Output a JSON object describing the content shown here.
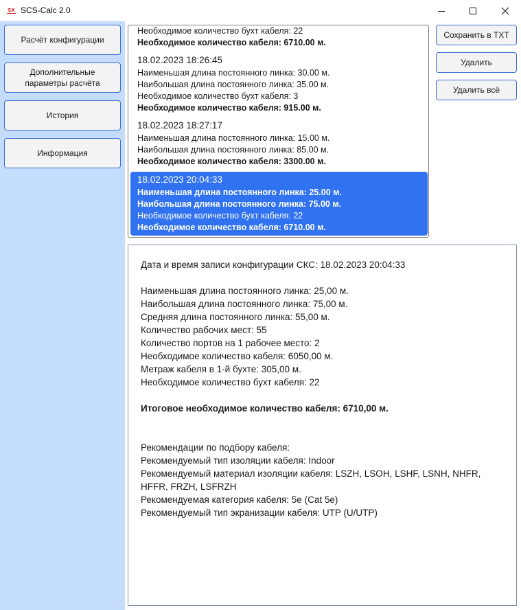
{
  "window": {
    "icon_text": "SX",
    "title": "SCS-Calc 2.0"
  },
  "sidebar": {
    "items": [
      {
        "label": "Расчёт конфигурации"
      },
      {
        "label": "Дополнительные\nпараметры расчёта"
      },
      {
        "label": "История"
      },
      {
        "label": "Информация"
      }
    ]
  },
  "history": {
    "partial": {
      "line1": "Необходимое количество бухт кабеля: 22",
      "line2": "Необходимое количество кабеля: 6710.00 м."
    },
    "entries": [
      {
        "date": "18.02.2023 18:26:45",
        "lines": [
          "Наименьшая длина постоянного линка: 30.00 м.",
          "Наибольшая длина постоянного линка: 35.00 м.",
          "Необходимое количество бухт кабеля: 3"
        ],
        "total": "Необходимое количество кабеля: 915.00 м."
      },
      {
        "date": "18.02.2023 18:27:17",
        "lines": [
          "Наименьшая длина постоянного линка: 15.00 м.",
          "Наибольшая длина постоянного линка: 85.00 м."
        ],
        "total": "Необходимое количество кабеля: 3300.00 м."
      },
      {
        "date": "18.02.2023 20:04:33",
        "lines": [
          "Наименьшая длина постоянного линка: 25.00 м.",
          "Наибольшая длина постоянного линка: 75.00 м.",
          "Необходимое количество бухт кабеля: 22"
        ],
        "total": "Необходимое количество кабеля: 6710.00 м.",
        "selected": true
      }
    ]
  },
  "actions": {
    "save_txt": "Сохранить в TXT",
    "delete": "Удалить",
    "delete_all": "Удалить всё"
  },
  "details": {
    "datetime": "Дата и время записи конфигурации СКС: 18.02.2023 20:04:33",
    "params": [
      "Наименьшая длина постоянного линка: 25,00 м.",
      "Наибольшая длина постоянного линка: 75,00 м.",
      "Средняя длина постоянного линка: 55,00 м.",
      "Количество рабочих мест: 55",
      "Количество портов на 1 рабочее место: 2",
      "Необходимое количество кабеля: 6050,00 м.",
      "Метраж кабеля в 1-й бухте: 305,00 м.",
      "Необходимое количество бухт кабеля: 22"
    ],
    "total": "Итоговое необходимое количество кабеля: 6710,00 м.",
    "recommendations": [
      "Рекомендации по подбору кабеля:",
      "Рекомендуемый тип изоляции кабеля: Indoor",
      "Рекомендуемый материал изоляции кабеля: LSZH, LSOH, LSHF, LSNH, NHFR, HFFR, FRZH, LSFRZH",
      "Рекомендуемая категория кабеля: 5e (Cat 5e)",
      "Рекомендуемый тип экранизации кабеля: UTP (U/UTP)"
    ]
  },
  "colors": {
    "sidebar_bg": "#c4ddfe",
    "accent_border": "#3c6fd0",
    "selection": "#3172f0"
  }
}
